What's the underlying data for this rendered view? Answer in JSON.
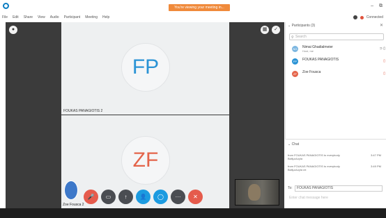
{
  "titlebar": {
    "banner": "You're viewing your meeting in...",
    "window_controls": [
      "–",
      "⧉"
    ]
  },
  "menubar": {
    "items": [
      "File",
      "Edit",
      "Share",
      "View",
      "Audio",
      "Participant",
      "Meeting",
      "Help"
    ],
    "status": "Connected"
  },
  "stage": {
    "tiles": [
      {
        "initials": "FP",
        "name": "FOUKAS PANAGIOTIS",
        "badge": "2"
      },
      {
        "initials": "ZF",
        "name": "",
        "badge": ""
      }
    ],
    "self": {
      "name": "Zoe Fousca",
      "badge": "2"
    }
  },
  "controls": {
    "items": [
      {
        "icon": "mic-off-icon",
        "glyph": "🎤",
        "color": "red"
      },
      {
        "icon": "video-off-icon",
        "glyph": "▭",
        "color": "dark"
      },
      {
        "icon": "share-icon",
        "glyph": "↑",
        "color": "dark"
      },
      {
        "icon": "participants-icon",
        "glyph": "👤",
        "color": "blue"
      },
      {
        "icon": "chat-icon",
        "glyph": "◯",
        "color": "blue"
      },
      {
        "icon": "more-icon",
        "glyph": "···",
        "color": "dark"
      },
      {
        "icon": "end-call-icon",
        "glyph": "✕",
        "color": "red"
      }
    ]
  },
  "participants": {
    "title": "Participants (3)",
    "search_placeholder": "Search",
    "list": [
      {
        "initials": "NG",
        "name": "Nimai Ghadialmeier",
        "sub": "Host, me",
        "avatar_color": "#7bb6e0"
      },
      {
        "initials": "FP",
        "name": "FOUKAS PANAGIOTIS",
        "sub": "",
        "avatar_color": "#2a93d5"
      },
      {
        "initials": "ZF",
        "name": "Zoe Fousca",
        "sub": "",
        "avatar_color": "#e4644a"
      }
    ]
  },
  "chat": {
    "title": "Chat",
    "messages": [
      {
        "from": "from FOUKAS PANAGIOTIS to everybody",
        "text": "Βαθμολογία",
        "time": "3:47 PM"
      },
      {
        "from": "from FOUKAS PANAGIOTIS to everybody",
        "text": "Βαθμολογία επ",
        "time": "3:49 PM"
      }
    ],
    "to_label": "To:",
    "to_value": "FOUKAS PANAGIOTIS",
    "input_placeholder": "Enter chat message here"
  }
}
